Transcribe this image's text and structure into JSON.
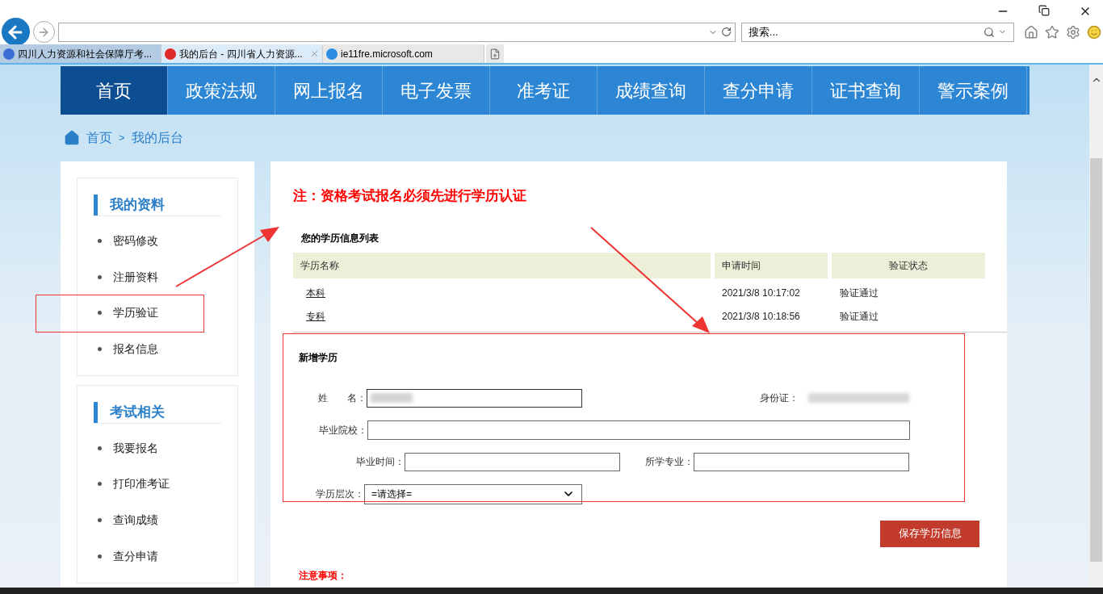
{
  "browser": {
    "search": {
      "placeholder": "搜索..."
    },
    "tabs": [
      {
        "title": "四川人力资源和社会保障厅考...",
        "selected": false,
        "closable": false
      },
      {
        "title": "我的后台 - 四川省人力资源...",
        "selected": true,
        "closable": true
      },
      {
        "title": "ie11fre.microsoft.com",
        "selected": false,
        "closable": false
      }
    ]
  },
  "nav": [
    {
      "label": "首页",
      "selected": true
    },
    {
      "label": "政策法规",
      "selected": false
    },
    {
      "label": "网上报名",
      "selected": false
    },
    {
      "label": "电子发票",
      "selected": false
    },
    {
      "label": "准考证",
      "selected": false
    },
    {
      "label": "成绩查询",
      "selected": false
    },
    {
      "label": "查分申请",
      "selected": false
    },
    {
      "label": "证书查询",
      "selected": false
    },
    {
      "label": "警示案例",
      "selected": false
    }
  ],
  "breadcrumb": {
    "items": [
      "首页",
      "我的后台"
    ],
    "separator": ">"
  },
  "sidebar": [
    {
      "title": "我的资料",
      "items": [
        "密码修改",
        "注册资料",
        "学历验证",
        "报名信息"
      ]
    },
    {
      "title": "考试相关",
      "items": [
        "我要报名",
        "打印准考证",
        "查询成绩",
        "查分申请"
      ]
    }
  ],
  "main": {
    "notice": "注：资格考试报名必须先进行学历认证",
    "list_title": "您的学历信息列表",
    "table": {
      "columns": [
        "学历名称",
        "申请时间",
        "验证状态"
      ],
      "rows": [
        {
          "name": "本科",
          "time": "2021/3/8 10:17:02",
          "status": "验证通过"
        },
        {
          "name": "专科",
          "time": "2021/3/8 10:18:56",
          "status": "验证通过"
        }
      ]
    },
    "form": {
      "title": "新增学历",
      "fields": [
        {
          "label": "姓　　名：",
          "kind": "blurred-input"
        },
        {
          "label": "身份证：",
          "kind": "blurred-text"
        },
        {
          "label": "毕业院校：",
          "kind": "wide-input"
        },
        {
          "label": "毕业时间：",
          "kind": "input"
        },
        {
          "label": "所学专业：",
          "kind": "input"
        },
        {
          "label": "学历层次：",
          "kind": "select",
          "value": "=请选择="
        }
      ],
      "button": "保存学历信息"
    },
    "note_title": "注意事项："
  }
}
